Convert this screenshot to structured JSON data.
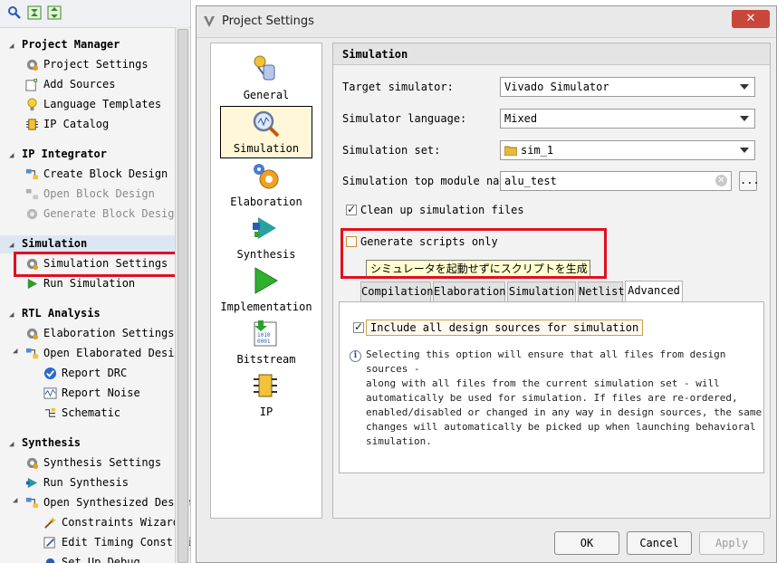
{
  "nav": {
    "sections": [
      {
        "label": "Project Manager"
      },
      {
        "label": "IP Integrator"
      },
      {
        "label": "Simulation"
      },
      {
        "label": "RTL Analysis"
      },
      {
        "label": "Synthesis"
      }
    ],
    "items": {
      "project_settings": "Project Settings",
      "add_sources": "Add Sources",
      "language_templates": "Language Templates",
      "ip_catalog": "IP Catalog",
      "create_block_design": "Create Block Design",
      "open_block_design": "Open Block Design",
      "generate_block_design": "Generate Block Design",
      "simulation_settings": "Simulation Settings",
      "run_simulation": "Run Simulation",
      "elaboration_settings": "Elaboration Settings",
      "open_elaborated_design": "Open Elaborated Design",
      "report_drc": "Report DRC",
      "report_noise": "Report Noise",
      "schematic": "Schematic",
      "synthesis_settings": "Synthesis Settings",
      "run_synthesis": "Run Synthesis",
      "open_synthesized_design": "Open Synthesized Design",
      "constraints_wizard": "Constraints Wizard",
      "edit_timing_constraints": "Edit Timing Constraints",
      "set_up_debug": "Set Up Debug"
    }
  },
  "dialog": {
    "title": "Project Settings",
    "close": "✕",
    "categories": [
      "General",
      "Simulation",
      "Elaboration",
      "Synthesis",
      "Implementation",
      "Bitstream",
      "IP"
    ],
    "panel_title": "Simulation",
    "fields": {
      "target_simulator_label": "Target simulator:",
      "target_simulator_value": "Vivado Simulator",
      "simulator_language_label": "Simulator language:",
      "simulator_language_value": "Mixed",
      "simulation_set_label": "Simulation set:",
      "simulation_set_value": "sim_1",
      "top_module_label": "Simulation top module name:",
      "top_module_value": "alu_test",
      "browse": "...",
      "cleanup_label": "Clean up simulation files",
      "cleanup_checked": true,
      "generate_scripts_label": "Generate scripts only",
      "generate_scripts_checked": false,
      "tooltip": "シミュレータを起動せずにスクリプトを生成"
    },
    "tabs": [
      "Compilation",
      "Elaboration",
      "Simulation",
      "Netlist",
      "Advanced"
    ],
    "active_tab": "Advanced",
    "advanced": {
      "include_label": "Include all design sources for simulation",
      "include_checked": true,
      "description_lines": [
        "Selecting this option will ensure that all files from design sources -",
        "along with all files from the current simulation set - will",
        "automatically be used for simulation. If files are re-ordered,",
        "enabled/disabled or changed in any way in design sources, the same",
        "changes will automatically be picked up when launching behavioral",
        "simulation."
      ]
    },
    "buttons": {
      "ok": "OK",
      "cancel": "Cancel",
      "apply": "Apply"
    }
  },
  "colors": {
    "highlight": "#e01020",
    "tooltip_bg": "#ffffcf",
    "selected_bg": "#fff7d8"
  }
}
